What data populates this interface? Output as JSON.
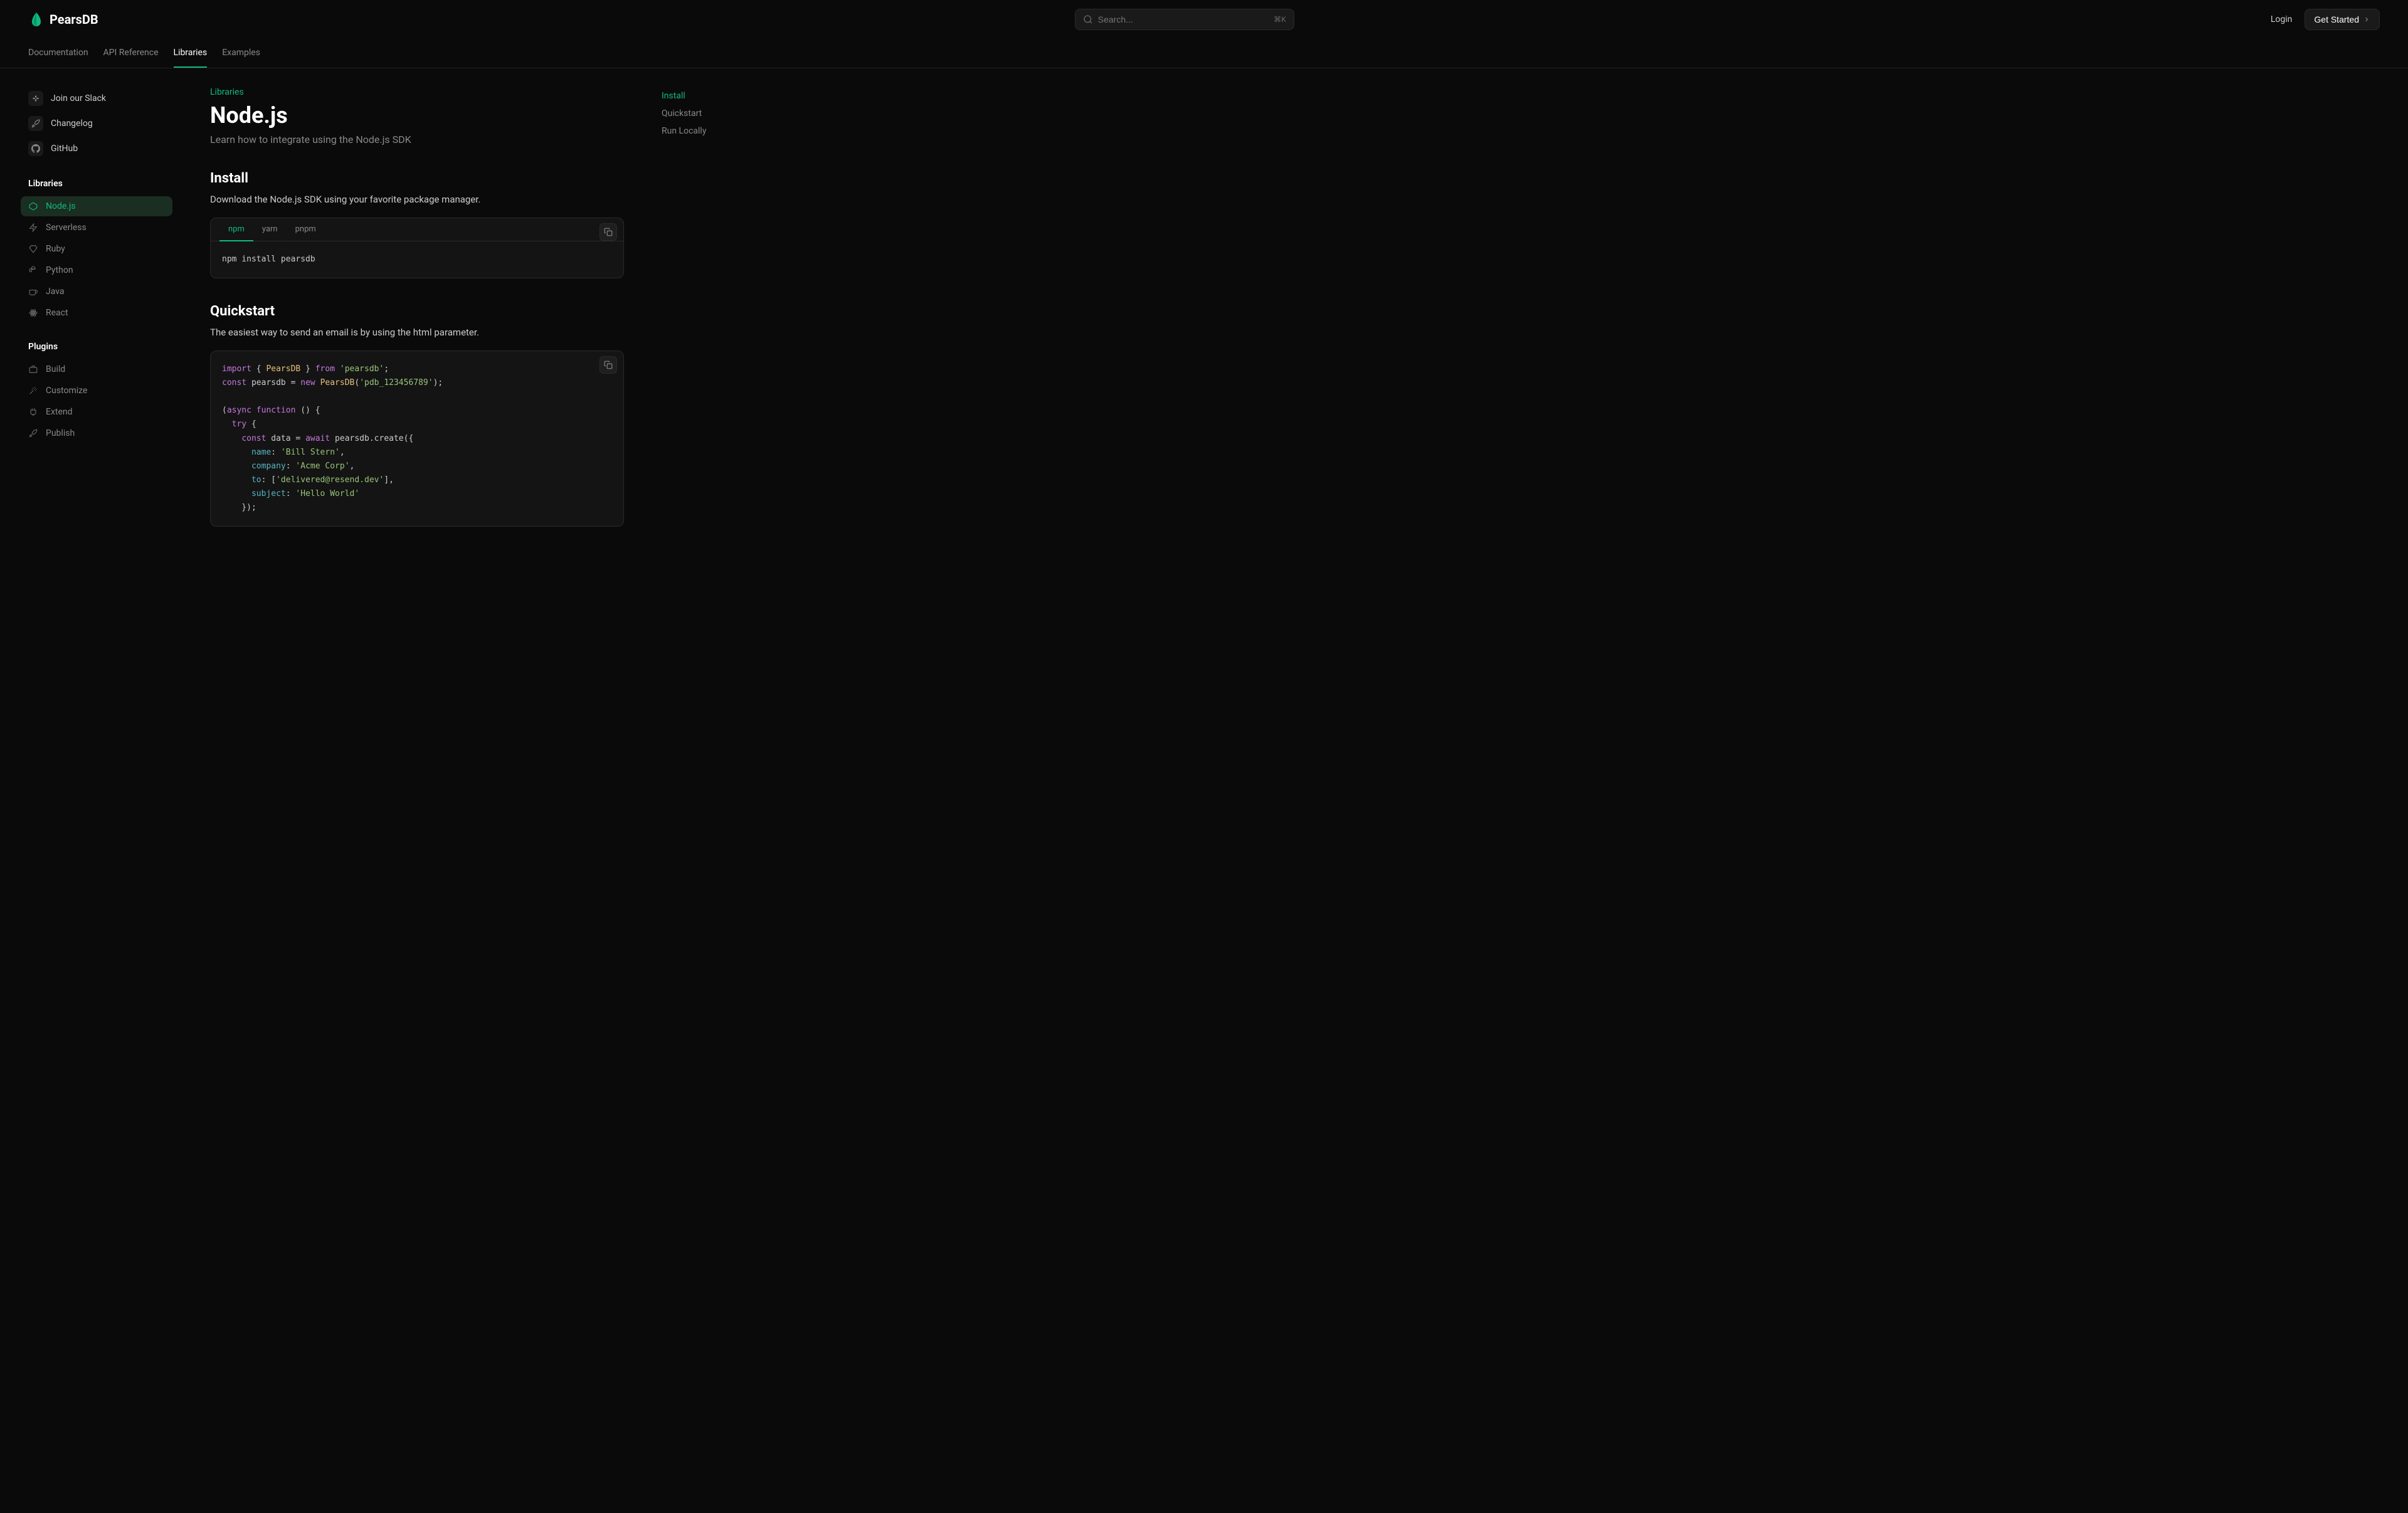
{
  "brand": "PearsDB",
  "search": {
    "placeholder": "Search...",
    "kbd": "⌘K"
  },
  "header": {
    "login": "Login",
    "get_started": "Get Started"
  },
  "tabs": {
    "documentation": "Documentation",
    "api_reference": "API Reference",
    "libraries": "Libraries",
    "examples": "Examples"
  },
  "external": {
    "slack": "Join our Slack",
    "changelog": "Changelog",
    "github": "GitHub"
  },
  "sidebar": {
    "libraries_heading": "Libraries",
    "plugins_heading": "Plugins",
    "libs": {
      "nodejs": "Node.js",
      "serverless": "Serverless",
      "ruby": "Ruby",
      "python": "Python",
      "java": "Java",
      "react": "React"
    },
    "plugins": {
      "build": "Build",
      "customize": "Customize",
      "extend": "Extend",
      "publish": "Publish"
    }
  },
  "page": {
    "breadcrumb": "Libraries",
    "title": "Node.js",
    "subtitle": "Learn how to integrate using the Node.js SDK"
  },
  "install": {
    "heading": "Install",
    "text": "Download the Node.js SDK using your favorite package manager.",
    "tabs": {
      "npm": "npm",
      "yarn": "yarn",
      "pnpm": "pnpm"
    },
    "cmd": "npm install pearsdb"
  },
  "quickstart": {
    "heading": "Quickstart",
    "text": "The easiest way to send an email is by using the html parameter."
  },
  "toc": {
    "install": "Install",
    "quickstart": "Quickstart",
    "run_locally": "Run Locally"
  },
  "code": {
    "import": "import",
    "from": "from",
    "pearsdb_cls": "PearsDB",
    "pearsdb_pkg": "'pearsdb'",
    "const": "const",
    "pearsdb_var": "pearsdb",
    "new": "new",
    "api_key": "'pdb_123456789'",
    "async": "async",
    "function": "function",
    "try": "try",
    "data": "data",
    "await": "await",
    "create": "create",
    "name_k": "name",
    "name_v": "'Bill Stern'",
    "company_k": "company",
    "company_v": "'Acme Corp'",
    "to_k": "to",
    "to_v": "'delivered@resend.dev'",
    "subject_k": "subject",
    "subject_v": "'Hello World'"
  }
}
